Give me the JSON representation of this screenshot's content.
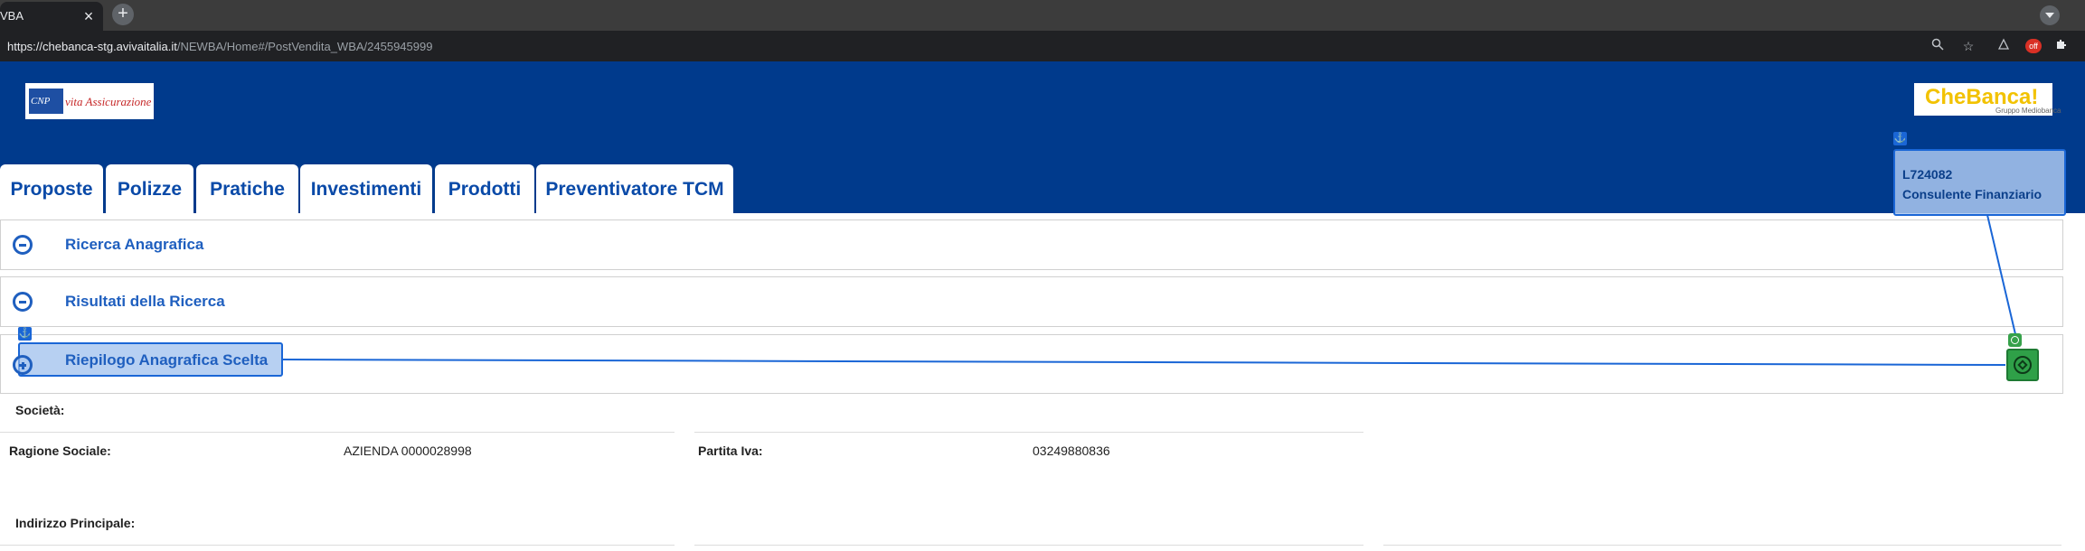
{
  "browser": {
    "tab_title": "VBA",
    "tab_close": "×",
    "new_tab": "+",
    "url_host": "https://chebanca-stg.avivaitalia.it",
    "url_path": "/NEWBA/Home#/PostVendita_WBA/2455945999",
    "icons": [
      "zoom-icon",
      "star-icon",
      "puzzle-icon",
      "extension-badge-icon",
      "extensions-icon"
    ],
    "ext_badge": "off"
  },
  "header": {
    "logo_left_text1": "CNP",
    "logo_left_text2": "vita Assicurazione",
    "logo_right_text": "CheBanca!",
    "logo_right_sub": "Gruppo Mediobanca",
    "nav_tabs": [
      {
        "label": "Proposte"
      },
      {
        "label": "Polizze"
      },
      {
        "label": "Pratiche"
      },
      {
        "label": "Investimenti"
      },
      {
        "label": "Prodotti"
      },
      {
        "label": "Preventivatore TCM"
      }
    ],
    "user": {
      "code": "L724082",
      "role": "Consulente Finanziario"
    }
  },
  "sections": [
    {
      "title": "Ricerca Anagrafica",
      "state": "expanded"
    },
    {
      "title": "Risultati della Ricerca",
      "state": "expanded"
    },
    {
      "title": "Riepilogo Anagrafica Scelta",
      "state": "collapsed"
    }
  ],
  "form": {
    "societa_label": "Società:",
    "ragione_sociale_label": "Ragione Sociale:",
    "ragione_sociale_value": "AZIENDA 0000028998",
    "partita_iva_label": "Partita Iva:",
    "partita_iva_value": "03249880836",
    "indirizzo_label": "Indirizzo Principale:"
  },
  "colors": {
    "header_blue": "#003a8c",
    "link_blue": "#1f5fbf",
    "annotation_blue": "#1a66d6",
    "annotation_green": "#2fa048"
  }
}
